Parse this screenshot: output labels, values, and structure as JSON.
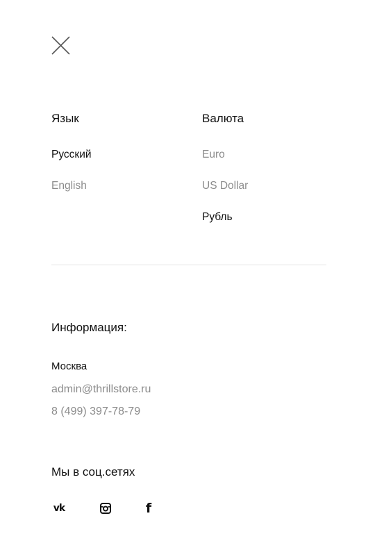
{
  "close": {
    "icon": "close-icon"
  },
  "language": {
    "title": "Язык",
    "options": [
      {
        "label": "Русский",
        "active": true
      },
      {
        "label": "English",
        "active": false
      }
    ]
  },
  "currency": {
    "title": "Валюта",
    "options": [
      {
        "label": "Euro",
        "active": false
      },
      {
        "label": "US Dollar",
        "active": false
      },
      {
        "label": "Рубль",
        "active": true
      }
    ]
  },
  "info": {
    "title": "Информация:",
    "city": "Москва",
    "email": "admin@thrillstore.ru",
    "phone": "8 (499) 397-78-79"
  },
  "social": {
    "title": "Мы в соц.сетях",
    "links": [
      {
        "icon": "vk-icon"
      },
      {
        "icon": "instagram-icon"
      },
      {
        "icon": "facebook-icon"
      }
    ]
  },
  "colors": {
    "text_primary": "#111111",
    "text_muted": "#8c8c8c",
    "divider": "#e2e2e2",
    "background": "#ffffff"
  }
}
